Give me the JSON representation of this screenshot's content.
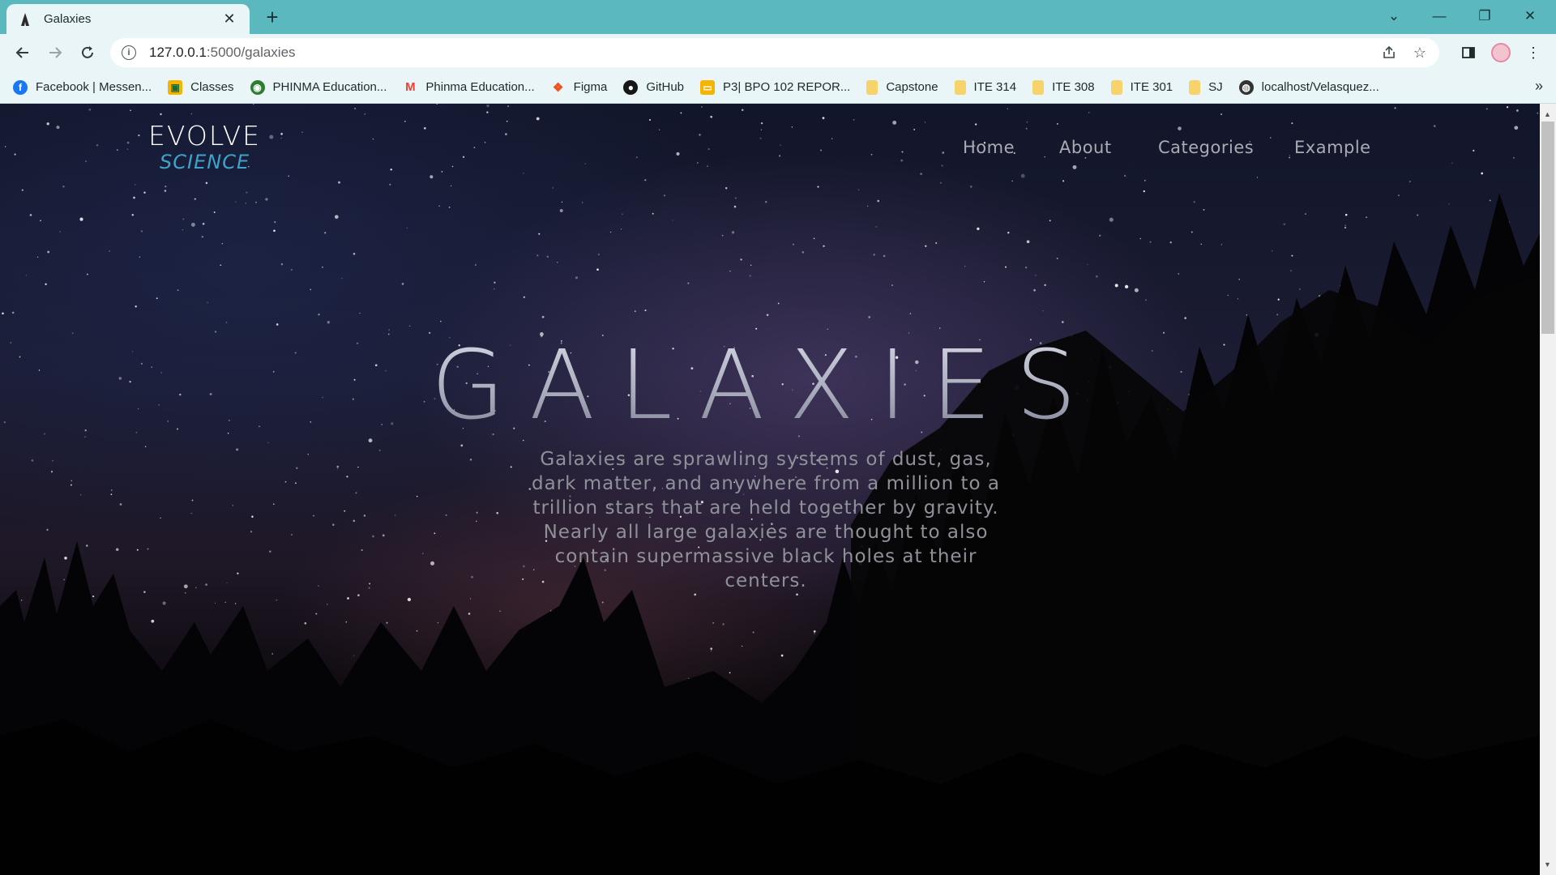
{
  "browser": {
    "tab_title": "Galaxies",
    "new_tab": "+",
    "url_host": "127.0.0.1",
    "url_rest": ":5000/galaxies",
    "bookmarks": [
      {
        "label": "Facebook | Messen...",
        "icon": "facebook-icon",
        "color": "#1877f2"
      },
      {
        "label": "Classes",
        "icon": "classroom-icon",
        "color": "#f4b400"
      },
      {
        "label": "PHINMA Education...",
        "icon": "globe-icon",
        "color": "#2e7d32"
      },
      {
        "label": "Phinma Education...",
        "icon": "gmail-icon",
        "color": "#ea4335"
      },
      {
        "label": "Figma",
        "icon": "figma-icon",
        "color": "#f24e1e"
      },
      {
        "label": "GitHub",
        "icon": "github-icon",
        "color": "#181717"
      },
      {
        "label": "P3| BPO 102 REPOR...",
        "icon": "slides-icon",
        "color": "#f4b400"
      },
      {
        "label": "Capstone",
        "icon": "folder-icon",
        "color": "#f6d36b"
      },
      {
        "label": "ITE 314",
        "icon": "folder-icon",
        "color": "#f6d36b"
      },
      {
        "label": "ITE 308",
        "icon": "folder-icon",
        "color": "#f6d36b"
      },
      {
        "label": "ITE 301",
        "icon": "folder-icon",
        "color": "#f6d36b"
      },
      {
        "label": "SJ",
        "icon": "folder-icon",
        "color": "#f6d36b"
      },
      {
        "label": "localhost/Velasquez...",
        "icon": "globe-icon",
        "color": "#333333"
      }
    ],
    "more": "»"
  },
  "page": {
    "logo_top": "EVOLVE",
    "logo_bottom": "SCIENCE",
    "nav": [
      "Home",
      "About",
      "Categories",
      "Example"
    ],
    "hero_title": "GALAXIES",
    "hero_description": "Galaxies are sprawling systems of dust, gas, dark matter, and anywhere from a million to a trillion stars that are held together by gravity. Nearly all large galaxies are thought to also contain supermassive black holes at their centers."
  }
}
